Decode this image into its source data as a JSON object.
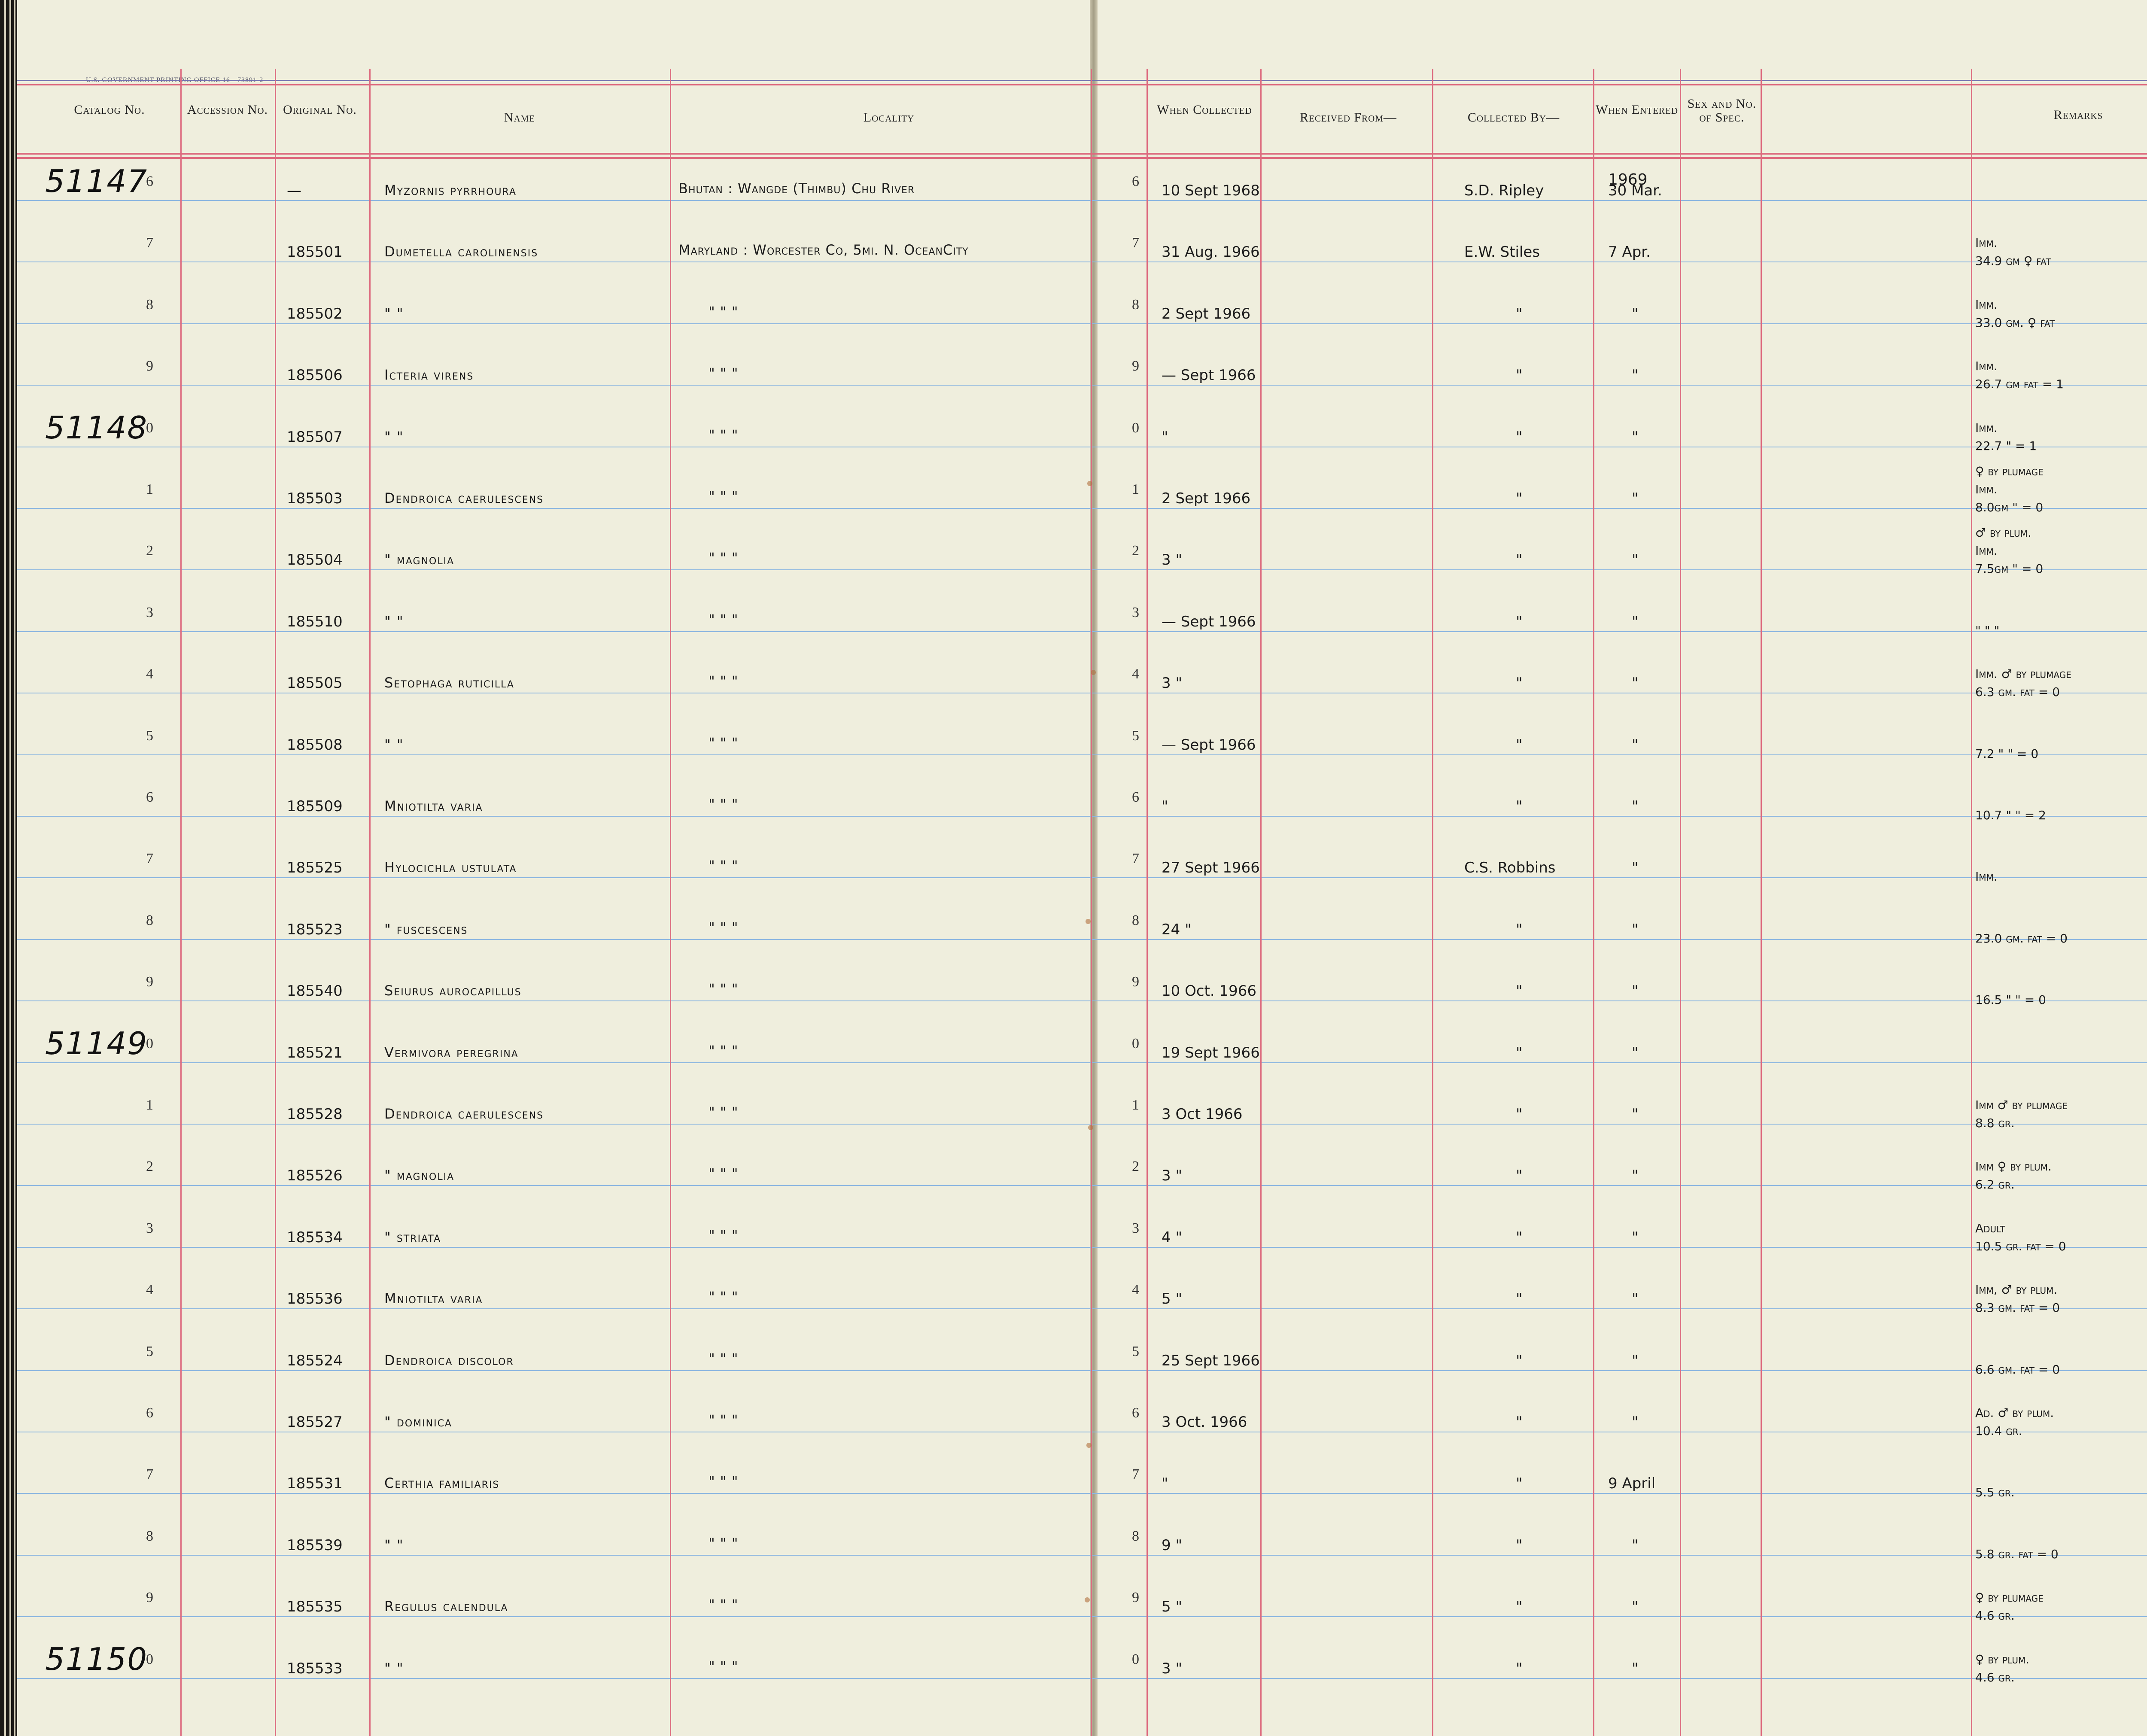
{
  "imprint": "U.S. GOVERNMENT PRINTING OFFICE   16—73891-2",
  "headers": {
    "catalog": "Catalog No.",
    "accession": "Accession No.",
    "original": "Original No.",
    "name": "Name",
    "locality": "Locality",
    "when_collected": "When Collected",
    "received_from": "Received From—",
    "collected_by": "Collected By—",
    "when_entered": "When Entered",
    "sex": "Sex and No. of Spec.",
    "remarks": "Remarks"
  },
  "year_note": "1969",
  "rows": [
    {
      "row_num": "6",
      "catalog": "51147",
      "original": "—",
      "name": "Myzornis pyrrhoura",
      "locality": "Bhutan : Wangde (Thimbu) Chu River",
      "collected": "10 Sept 1968",
      "collector": "S.D. Ripley",
      "entered": "30 Mar.",
      "remarks": []
    },
    {
      "row_num": "7",
      "catalog": "",
      "original": "185501",
      "name": "Dumetella carolinensis",
      "locality": "Maryland : Worcester Co, 5mi. N. OceanCity",
      "collected": "31 Aug. 1966",
      "collector": "E.W. Stiles",
      "entered": "7 Apr.",
      "remarks": [
        "Imm.",
        "34.9 gm ♀ fat"
      ]
    },
    {
      "row_num": "8",
      "catalog": "",
      "original": "185502",
      "name": "\"        \"",
      "locality": "\"        \"        \"",
      "collected": "2 Sept 1966",
      "collector": "\"",
      "entered": "\"",
      "remarks": [
        "Imm.",
        "33.0 gm. ♀ fat"
      ]
    },
    {
      "row_num": "9",
      "catalog": "",
      "original": "185506",
      "name": "Icteria virens",
      "locality": "\"        \"        \"",
      "collected": "— Sept 1966",
      "collector": "\"",
      "entered": "\"",
      "remarks": [
        "Imm.",
        "26.7 gm fat = 1"
      ]
    },
    {
      "row_num": "0",
      "catalog": "51148",
      "original": "185507",
      "name": "\"     \"",
      "locality": "\"        \"        \"",
      "collected": "\"",
      "collector": "\"",
      "entered": "\"",
      "remarks": [
        "Imm.",
        "22.7    \" = 1"
      ]
    },
    {
      "row_num": "1",
      "catalog": "",
      "original": "185503",
      "name": "Dendroica caerulescens",
      "locality": "\"        \"        \"",
      "collected": "2 Sept 1966",
      "collector": "\"",
      "entered": "\"",
      "remarks": [
        "♀ by plumage",
        "Imm.",
        "8.0gm  \" = 0"
      ]
    },
    {
      "row_num": "2",
      "catalog": "",
      "original": "185504",
      "name": "\"        magnolia",
      "locality": "\"        \"        \"",
      "collected": "3  \"",
      "collector": "\"",
      "entered": "\"",
      "remarks": [
        "♂ by plum.",
        "Imm.",
        "7.5gm  \" = 0"
      ]
    },
    {
      "row_num": "3",
      "catalog": "",
      "original": "185510",
      "name": "\"        \"",
      "locality": "\"        \"        \"",
      "collected": "— Sept 1966",
      "collector": "\"",
      "entered": "\"",
      "remarks": [
        "\"  \"  \""
      ]
    },
    {
      "row_num": "4",
      "catalog": "",
      "original": "185505",
      "name": "Setophaga ruticilla",
      "locality": "\"        \"        \"",
      "collected": "3  \"",
      "collector": "\"",
      "entered": "\"",
      "remarks": [
        "Imm. ♂ by plumage",
        "6.3 gm. fat = 0"
      ]
    },
    {
      "row_num": "5",
      "catalog": "",
      "original": "185508",
      "name": "\"        \"",
      "locality": "\"        \"        \"",
      "collected": "— Sept 1966",
      "collector": "\"",
      "entered": "\"",
      "remarks": [
        "7.2 \"   \" = 0"
      ]
    },
    {
      "row_num": "6",
      "catalog": "",
      "original": "185509",
      "name": "Mniotilta varia",
      "locality": "\"        \"        \"",
      "collected": "\"",
      "collector": "\"",
      "entered": "\"",
      "remarks": [
        "10.7 \"   \" = 2"
      ]
    },
    {
      "row_num": "7",
      "catalog": "",
      "original": "185525",
      "name": "Hylocichla ustulata",
      "locality": "\"        \"        \"",
      "collected": "27 Sept 1966",
      "collector": "C.S. Robbins",
      "entered": "\"",
      "remarks": [
        "Imm."
      ]
    },
    {
      "row_num": "8",
      "catalog": "",
      "original": "185523",
      "name": "\"      fuscescens",
      "locality": "\"        \"        \"",
      "collected": "24  \"",
      "collector": "\"",
      "entered": "\"",
      "remarks": [
        "23.0 gm. fat = 0"
      ]
    },
    {
      "row_num": "9",
      "catalog": "",
      "original": "185540",
      "name": "Seiurus aurocapillus",
      "locality": "\"        \"        \"",
      "collected": "10 Oct. 1966",
      "collector": "\"",
      "entered": "\"",
      "remarks": [
        "16.5 \"   \" = 0"
      ]
    },
    {
      "row_num": "0",
      "catalog": "51149",
      "original": "185521",
      "name": "Vermivora peregrina",
      "locality": "\"        \"        \"",
      "collected": "19 Sept 1966",
      "collector": "\"",
      "entered": "\"",
      "remarks": []
    },
    {
      "row_num": "1",
      "catalog": "",
      "original": "185528",
      "name": "Dendroica caerulescens",
      "locality": "\"        \"        \"",
      "collected": "3 Oct 1966",
      "collector": "\"",
      "entered": "\"",
      "remarks": [
        "Imm ♂ by plumage",
        "8.8 gr."
      ]
    },
    {
      "row_num": "2",
      "catalog": "",
      "original": "185526",
      "name": "\"        magnolia",
      "locality": "\"        \"        \"",
      "collected": "3  \"",
      "collector": "\"",
      "entered": "\"",
      "remarks": [
        "Imm ♀ by plum.",
        "6.2 gr."
      ]
    },
    {
      "row_num": "3",
      "catalog": "",
      "original": "185534",
      "name": "\"        striata",
      "locality": "\"        \"        \"",
      "collected": "4  \"",
      "collector": "\"",
      "entered": "\"",
      "remarks": [
        "Adult",
        "10.5 gr. fat = 0"
      ]
    },
    {
      "row_num": "4",
      "catalog": "",
      "original": "185536",
      "name": "Mniotilta varia",
      "locality": "\"        \"        \"",
      "collected": "5  \"",
      "collector": "\"",
      "entered": "\"",
      "remarks": [
        "Imm, ♂ by plum.",
        "8.3 gm. fat = 0"
      ]
    },
    {
      "row_num": "5",
      "catalog": "",
      "original": "185524",
      "name": "Dendroica discolor",
      "locality": "\"        \"        \"",
      "collected": "25 Sept 1966",
      "collector": "\"",
      "entered": "\"",
      "remarks": [
        "6.6 gm. fat = 0"
      ]
    },
    {
      "row_num": "6",
      "catalog": "",
      "original": "185527",
      "name": "\"        dominica",
      "locality": "\"        \"        \"",
      "collected": "3 Oct. 1966",
      "collector": "\"",
      "entered": "\"",
      "remarks": [
        "Ad. ♂ by plum.",
        "10.4 gr."
      ]
    },
    {
      "row_num": "7",
      "catalog": "",
      "original": "185531",
      "name": "Certhia familiaris",
      "locality": "\"        \"        \"",
      "collected": "\"",
      "collector": "\"",
      "entered": "9 April",
      "remarks": [
        "5.5 gr."
      ]
    },
    {
      "row_num": "8",
      "catalog": "",
      "original": "185539",
      "name": "\"        \"",
      "locality": "\"        \"        \"",
      "collected": "9  \"",
      "collector": "\"",
      "entered": "\"",
      "remarks": [
        "5.8 gr. fat = 0"
      ]
    },
    {
      "row_num": "9",
      "catalog": "",
      "original": "185535",
      "name": "Regulus calendula",
      "locality": "\"        \"        \"",
      "collected": "5  \"",
      "collector": "\"",
      "entered": "\"",
      "remarks": [
        "♀ by plumage",
        "4.6 gr."
      ]
    },
    {
      "row_num": "0",
      "catalog": "51150",
      "original": "185533",
      "name": "\"        \"",
      "locality": "\"        \"        \"",
      "collected": "3  \"",
      "collector": "\"",
      "entered": "\"",
      "remarks": [
        "♀ by plum.",
        "4.6 gr."
      ]
    }
  ]
}
